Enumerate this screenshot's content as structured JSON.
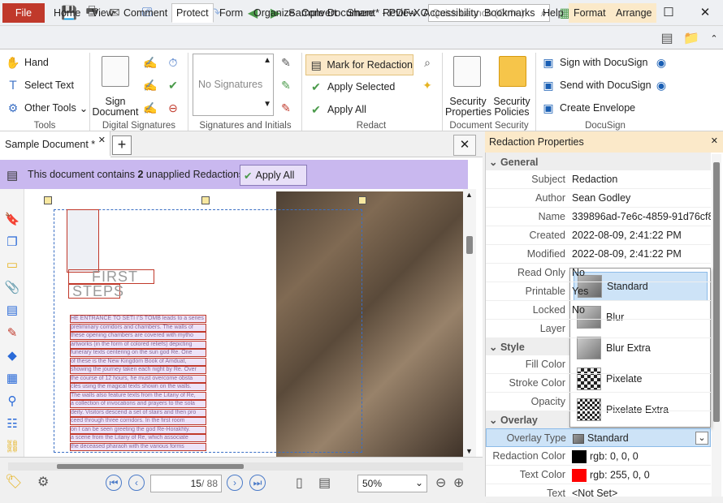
{
  "window": {
    "title": "Sample Document* - PDF-XCh...",
    "quick_launch": "Quick Launch (Ctrl+.)"
  },
  "ribbon_tabs": [
    "File",
    "Home",
    "View",
    "Comment",
    "Protect",
    "Form",
    "Organize",
    "Convert",
    "Share",
    "Review",
    "Accessibility",
    "Bookmarks",
    "Help",
    "Format",
    "Arrange"
  ],
  "tools": {
    "hand": "Hand",
    "select_text": "Select Text",
    "other_tools": "Other Tools",
    "label": "Tools"
  },
  "digital_signatures": {
    "sign_document": "Sign Document",
    "label": "Digital Signatures"
  },
  "signatures_initials": {
    "placeholder": "No Signatures",
    "label": "Signatures and Initials"
  },
  "redact": {
    "mark": "Mark for Redaction",
    "apply_selected": "Apply Selected",
    "apply_all": "Apply All",
    "label": "Redact"
  },
  "doc_security": {
    "security_properties": "Security Properties",
    "security_policies": "Security Policies",
    "label": "Document Security"
  },
  "docusign": {
    "sign": "Sign with DocuSign",
    "send": "Send with DocuSign",
    "create": "Create Envelope",
    "label": "DocuSign"
  },
  "document": {
    "tab": "Sample Document *",
    "banner_prefix": "This document contains ",
    "banner_count": "2",
    "banner_suffix": " unapplied Redactions.",
    "apply_all": "Apply All",
    "heading1": "FIRST",
    "heading2": "STEPS",
    "body_lines": [
      "HE ENTRANCE TO SETI I'S TOMB leads to a series of",
      "preliminary corridors and chambers. The walls of",
      "these opening chambers are covered with mytho",
      "artworks (in the form of colored reliefs) depicting",
      "funerary texts centering on the sun god Re. One",
      "of these is the New Kingdom Book of Amduat,",
      "showing the journey taken each night by Re. Over",
      "the course of 12 hours, he must overcome obsta",
      "cles using the magical texts shown on the walls.",
      "The walls also feature texts from the Litany of Re,",
      "a collection of invocations and prayers to the sola",
      "deity. Visitors descend a set of stairs and then pro",
      "ceed through three corridors. In the first room",
      "on I can be seen greeting the god Re-Horakhty.",
      "a scene from the Litany of Re, which associate",
      "the deceased pharaoh with the various forms"
    ]
  },
  "navigation": {
    "page_current": "15",
    "page_total": "/ 88",
    "zoom": "50%"
  },
  "panel": {
    "title": "Redaction Properties",
    "sections": {
      "general": "General",
      "style": "Style",
      "overlay": "Overlay"
    },
    "general": [
      {
        "k": "Subject",
        "v": "Redaction"
      },
      {
        "k": "Author",
        "v": "Sean Godley"
      },
      {
        "k": "Name",
        "v": "339896ad-7e6c-4859-91d76cf8..."
      },
      {
        "k": "Created",
        "v": "2022-08-09, 2:41:22 PM"
      },
      {
        "k": "Modified",
        "v": "2022-08-09, 2:41:22 PM"
      },
      {
        "k": "Read Only",
        "v": "No"
      },
      {
        "k": "Printable",
        "v": "Yes"
      },
      {
        "k": "Locked",
        "v": "No"
      },
      {
        "k": "Layer",
        "v": ""
      }
    ],
    "style": [
      {
        "k": "Fill Color",
        "v": ""
      },
      {
        "k": "Stroke Color",
        "v": ""
      },
      {
        "k": "Opacity",
        "v": ""
      }
    ],
    "overlay": [
      {
        "k": "Overlay Type",
        "v": "Standard"
      },
      {
        "k": "Redaction Color",
        "v": "rgb: 0, 0, 0"
      },
      {
        "k": "Text Color",
        "v": "rgb: 255, 0, 0"
      },
      {
        "k": "Text",
        "v": "<Not Set>"
      }
    ],
    "dropdown": [
      "Standard",
      "Blur",
      "Blur Extra",
      "Pixelate",
      "Pixelate Extra"
    ]
  },
  "colors": {
    "accent_file": "#c0392b",
    "banner": "#c9b8ef",
    "redaction": "#000000",
    "text_color": "#ff0000",
    "panel_header": "#fbe9c9"
  }
}
